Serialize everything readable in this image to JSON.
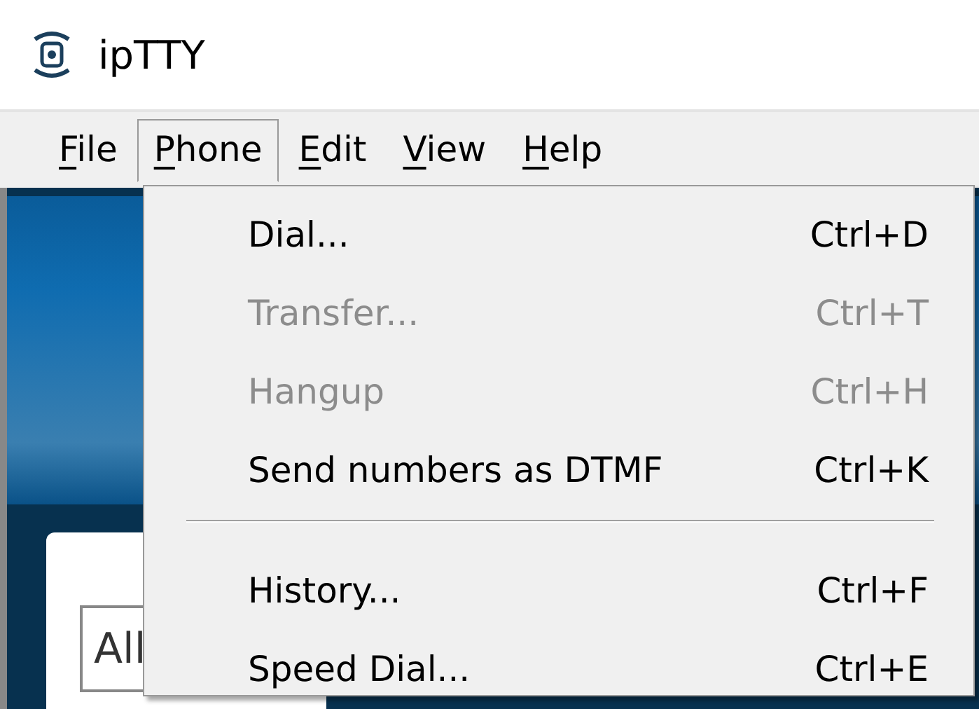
{
  "window": {
    "title": "ipTTY"
  },
  "menu_bar": [
    {
      "key": "F",
      "rest": "ile",
      "selected": false
    },
    {
      "key": "P",
      "rest": "hone",
      "selected": true
    },
    {
      "key": "E",
      "rest": "dit",
      "selected": false
    },
    {
      "key": "V",
      "rest": "iew",
      "selected": false
    },
    {
      "key": "H",
      "rest": "elp",
      "selected": false
    }
  ],
  "dropdown": [
    {
      "kind": "item",
      "label": "Dial...",
      "shortcut": "Ctrl+D",
      "disabled": false
    },
    {
      "kind": "item",
      "label": "Transfer...",
      "shortcut": "Ctrl+T",
      "disabled": true
    },
    {
      "kind": "item",
      "label": "Hangup",
      "shortcut": "Ctrl+H",
      "disabled": true
    },
    {
      "kind": "item",
      "label": "Send numbers as DTMF",
      "shortcut": "Ctrl+K",
      "disabled": false
    },
    {
      "kind": "separator"
    },
    {
      "kind": "item",
      "label": "History...",
      "shortcut": "Ctrl+F",
      "disabled": false
    },
    {
      "kind": "item",
      "label": "Speed Dial...",
      "shortcut": "Ctrl+E",
      "disabled": false
    }
  ],
  "search_field": {
    "value": "All"
  }
}
